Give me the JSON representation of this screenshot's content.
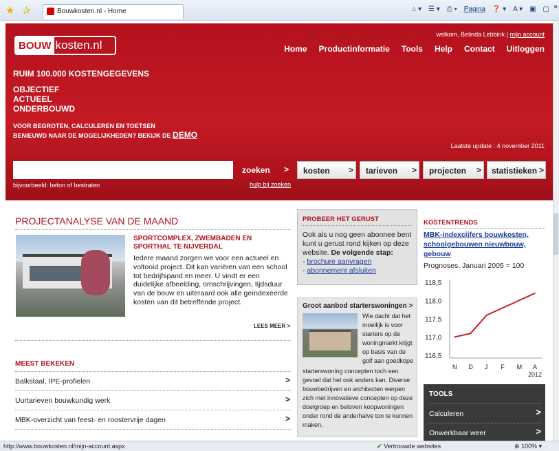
{
  "browser": {
    "tab_title": "Bouwkosten.nl - Home",
    "pagina_label": "Pagina",
    "status_url": "http://www.bouwkosten.nl/mijn-account.aspx",
    "trusted_sites": "Vertrouwde websites",
    "zoom": "100%"
  },
  "header": {
    "logo_part1": "BOUW",
    "logo_part2": "kosten.nl",
    "welcome_prefix": "welkom, Belinda Lebbink |",
    "account_link": "mijn account",
    "nav": [
      "Home",
      "Productinformatie",
      "Tools",
      "Help",
      "Contact",
      "Uitloggen"
    ],
    "tagline1": "RUIM 100.000 KOSTENGEGEVENS",
    "tagline2": [
      "OBJECTIEF",
      "ACTUEEL",
      "ONDERBOUWD"
    ],
    "tagline3a": "VOOR BEGROTEN, CALCULEREN EN TOETSEN",
    "tagline3b": "BENIEUWD NAAR DE MOGELIJKHEDEN? BEKIJK DE",
    "demo_link": "DEMO",
    "last_update": "Laatste update : 4 november 2011"
  },
  "search": {
    "button": "zoeken",
    "example": "bijvoorbeeld: beton of bestraten",
    "help": "hulp bij zoeken",
    "categories": [
      "kosten",
      "tarieven",
      "projecten",
      "statistieken"
    ]
  },
  "project": {
    "heading": "PROJECTANALYSE VAN DE MAAND",
    "subtitle": "SPORTCOMPLEX, ZWEMBADEN EN SPORTHAL TE NIJVERDAL",
    "text": "Iedere maand zorgen we voor een actueel en voltooid project. Dit kan variëren van een school tot bedrijfspand en meer. U vindt er een duidelijke afbeelding, omschrijvingen, tijdsduur van de bouw en uiteraard ook alle geïndexeerde kosten van dit betreffende project.",
    "more": "LEES MEER"
  },
  "meest": {
    "heading": "MEEST BEKEKEN",
    "items": [
      "Balkstaal, IPE-profielen",
      "Uurtarieven bouwkundig werk",
      "MBK-overzicht van feest- en roostervrije dagen"
    ]
  },
  "gerust": {
    "heading": "PROBEER HET GERUST",
    "text": "Ook als u nog geen abonnee bent kunt u gerust rond kijken op deze website.",
    "next_label": "De volgende stap:",
    "link1": "brochure aanvragen",
    "link2": "abonnement afsluiten"
  },
  "starter": {
    "heading": "Groot aanbod starterswoningen",
    "text1": "Wie dacht dat het moeilijk is voor starters op de woningmarkt krijgt op basis van de golf aan goedkope",
    "text2": "starterswoning concepten toch een gevoel dat het ook anders kan. Diverse bouwbedrijven en architecten werpen zich met innovatieve concepten op deze doelgroep en beloven koopwoningen onder rond de anderhalve ton te kunnen maken."
  },
  "trends": {
    "heading": "KOSTENTRENDS",
    "link": "MBK-indexcijfers bouwkosten, schoolgebouwen nieuwbouw, gebouw",
    "note": "Prognoses. Januari 2005 = 100"
  },
  "chart_data": {
    "type": "line",
    "categories": [
      "N",
      "D",
      "J",
      "F",
      "M",
      "A"
    ],
    "year_label": "2012",
    "values": [
      117.0,
      117.1,
      117.6,
      117.8,
      118.0,
      118.2
    ],
    "ylim": [
      116.5,
      118.5
    ],
    "yticks": [
      "118,5",
      "118,0",
      "117,5",
      "117,0",
      "116,5"
    ],
    "color": "#cc1c24",
    "grid": false
  },
  "tools": {
    "heading": "TOOLS",
    "items": [
      "Calculeren",
      "Onwerkbaar weer"
    ]
  }
}
